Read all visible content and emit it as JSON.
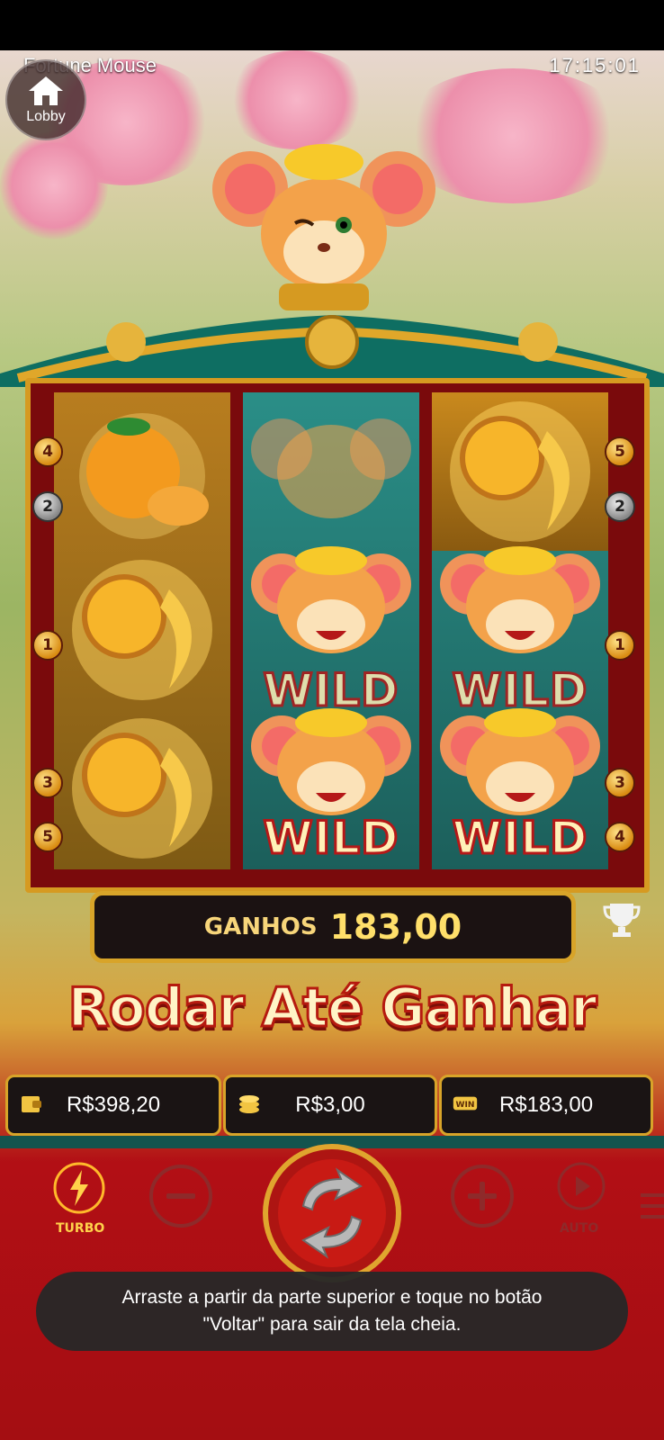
{
  "header": {
    "game_title": "Fortune Mouse",
    "clock": "17:15:01",
    "lobby_label": "Lobby"
  },
  "reels": {
    "wild_label": "WILD",
    "left_markers": [
      "4",
      "2",
      "1",
      "3",
      "5"
    ],
    "right_markers": [
      "5",
      "2",
      "1",
      "3",
      "4"
    ]
  },
  "win_panel": {
    "label": "GANHOS",
    "value": "183,00"
  },
  "banner": "Rodar Até Ganhar",
  "info": {
    "balance": "R$398,20",
    "bet": "R$3,00",
    "win": "R$183,00",
    "win_icon_text": "WIN"
  },
  "controls": {
    "turbo_label": "TURBO",
    "auto_label": "AUTO"
  },
  "toast": {
    "text": "Arraste a partir da parte superior e toque no botão\n\"Voltar\" para sair da tela cheia."
  },
  "colors": {
    "gold": "#d8a429",
    "dark_panel": "#1b1212",
    "red_bg": "#a40e12",
    "teal": "#14544e"
  }
}
